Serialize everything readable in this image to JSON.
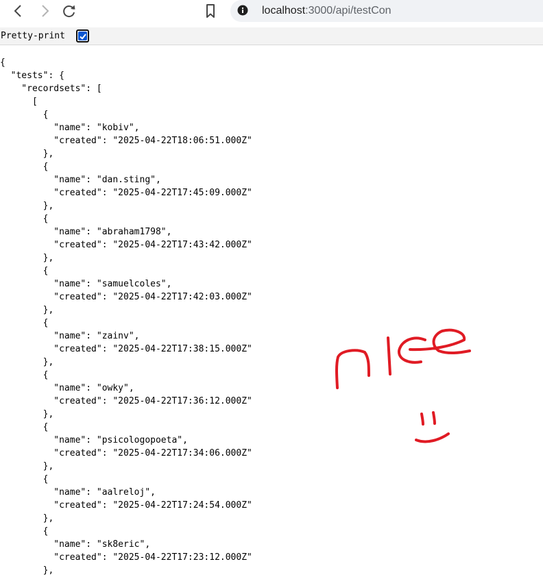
{
  "browser": {
    "url_host": "localhost",
    "url_path": ":3000/api/testCon"
  },
  "viewer": {
    "pretty_print_label": "Pretty-print",
    "pretty_print_checked": true
  },
  "records": [
    {
      "name": "kobiv",
      "created": "2025-04-22T18:06:51.000Z"
    },
    {
      "name": "dan.sting",
      "created": "2025-04-22T17:45:09.000Z"
    },
    {
      "name": "abraham1798",
      "created": "2025-04-22T17:43:42.000Z"
    },
    {
      "name": "samuelcoles",
      "created": "2025-04-22T17:42:03.000Z"
    },
    {
      "name": "zainv",
      "created": "2025-04-22T17:38:15.000Z"
    },
    {
      "name": "owky",
      "created": "2025-04-22T17:36:12.000Z"
    },
    {
      "name": "psicologopoeta",
      "created": "2025-04-22T17:34:06.000Z"
    },
    {
      "name": "aalreloj",
      "created": "2025-04-22T17:24:54.000Z"
    },
    {
      "name": "sk8eric",
      "created": "2025-04-22T17:23:12.000Z"
    }
  ],
  "annotation": {
    "handwritten_text": "nice",
    "color": "#e01b24"
  }
}
